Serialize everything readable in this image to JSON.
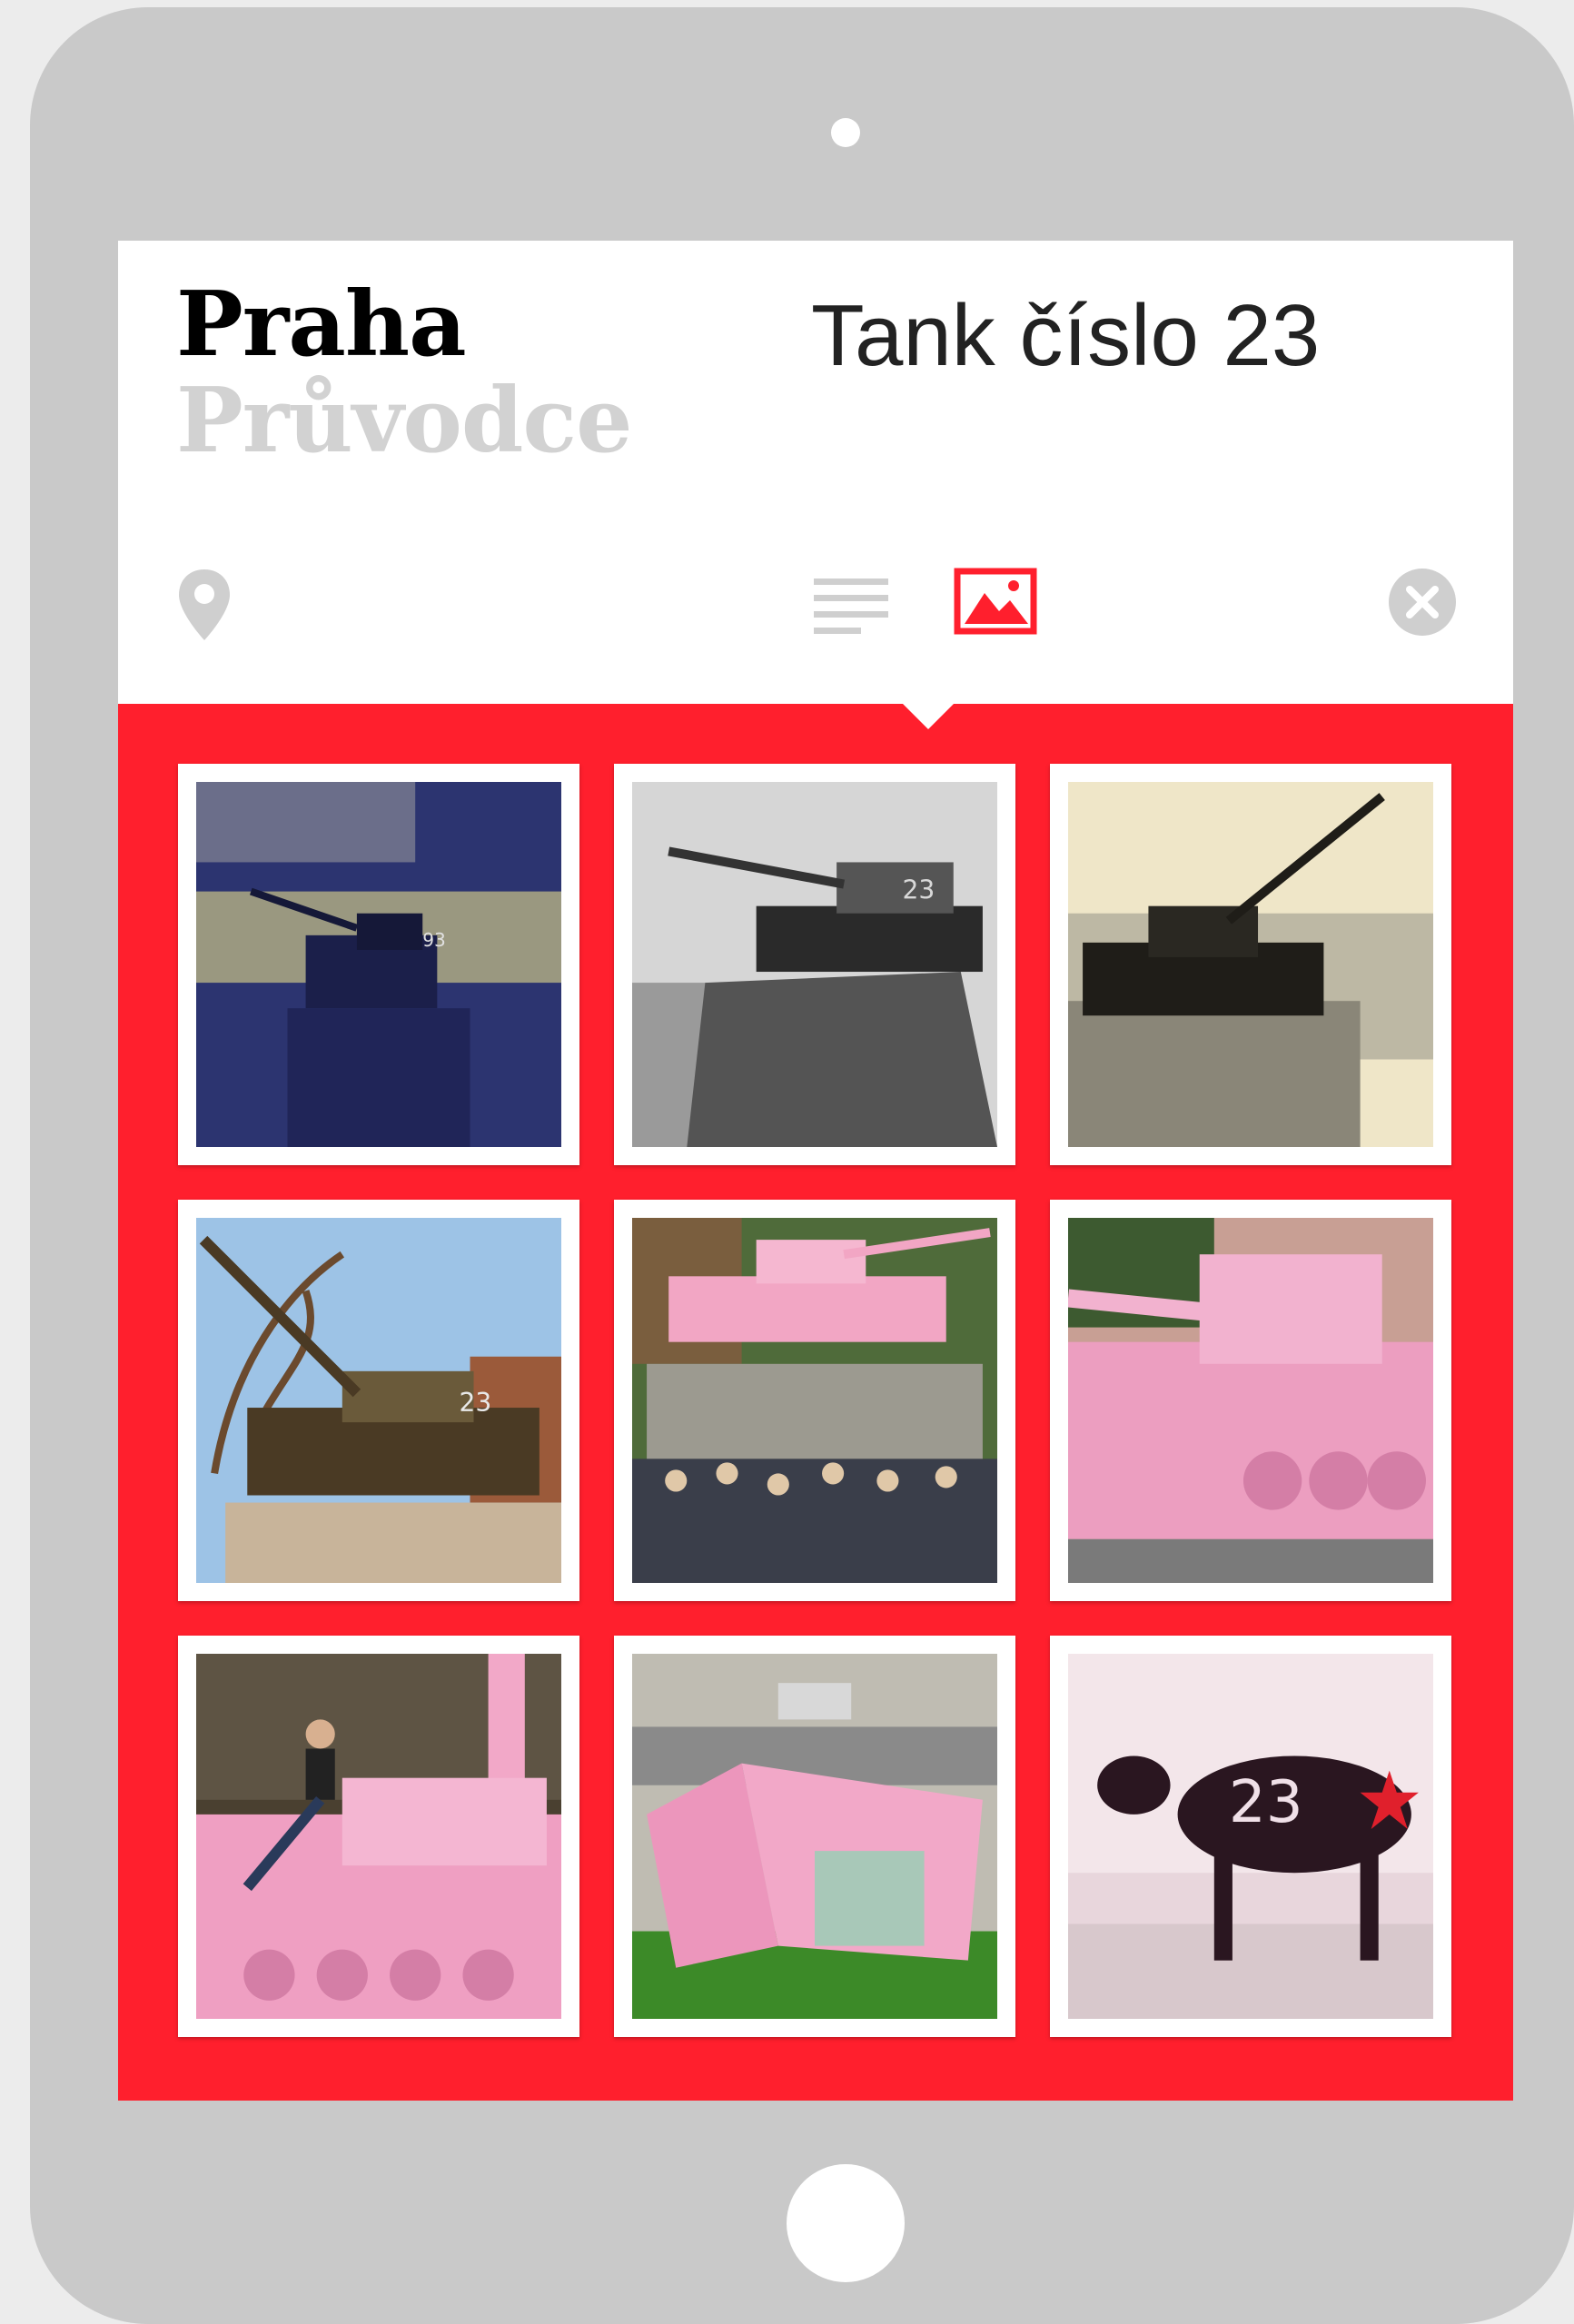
{
  "app": {
    "brand_primary": "Praha",
    "brand_secondary": "Průvodce"
  },
  "page": {
    "title": "Tank číslo 23"
  },
  "toolbar": {
    "location_icon": "map-pin-icon",
    "text_view_icon": "list-icon",
    "gallery_view_icon": "image-icon",
    "close_icon": "close-icon",
    "active_view": "gallery"
  },
  "colors": {
    "accent": "#ff1f2d",
    "tablet_frame": "#c9c9c9",
    "muted_text": "#d2d2d2"
  },
  "gallery": {
    "photos": [
      {
        "subject": "tank-blue-archival-photo",
        "caption": "93"
      },
      {
        "subject": "tank-monochrome-photo",
        "caption": "23"
      },
      {
        "subject": "tank-sepia-photo",
        "caption": ""
      },
      {
        "subject": "tank-color-photo",
        "caption": "23"
      },
      {
        "subject": "pink-tank-crowd-photo",
        "caption": ""
      },
      {
        "subject": "pink-tank-closeup-photo",
        "caption": ""
      },
      {
        "subject": "pink-tank-person-photo",
        "caption": ""
      },
      {
        "subject": "pink-tank-on-grass-photo",
        "caption": ""
      },
      {
        "subject": "cow-statue-photo",
        "caption": "23"
      }
    ]
  }
}
